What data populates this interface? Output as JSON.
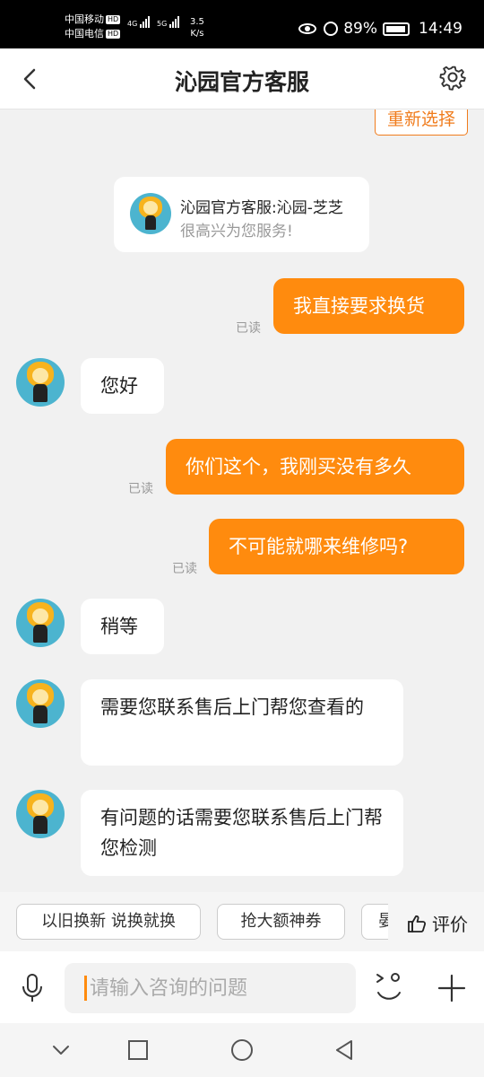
{
  "status_bar": {
    "carrier_1": "中国移动",
    "carrier_2": "中国电信",
    "hd": "HD",
    "net_1": "4G",
    "net_2": "5G",
    "speed_value": "3.5",
    "speed_unit": "K/s",
    "battery": "89%",
    "time": "14:49"
  },
  "header": {
    "title": "沁园官方客服"
  },
  "chat": {
    "reselect_label": "重新选择",
    "intro": {
      "name": "沁园官方客服:沁园-芝芝",
      "greeting": "很高兴为您服务!"
    },
    "read_label": "已读",
    "messages": [
      {
        "side": "right",
        "text": "我直接要求换货"
      },
      {
        "side": "left",
        "text": "您好"
      },
      {
        "side": "right",
        "text": "你们这个，我刚买没有多久"
      },
      {
        "side": "right",
        "text": "不可能就哪来维修吗?"
      },
      {
        "side": "left",
        "text": "稍等"
      },
      {
        "side": "left",
        "text": "需要您联系售后上门帮您查看的"
      },
      {
        "side": "left",
        "text": "有问题的话需要您联系售后上门帮您检测"
      }
    ]
  },
  "quick_bar": {
    "chips": [
      "以旧换新 说换就换",
      "抢大额神券",
      "晏"
    ],
    "rate_label": "评价"
  },
  "input": {
    "placeholder": "请输入咨询的问题"
  },
  "icons": {
    "back": "chevron-left-icon",
    "settings": "gear-icon",
    "mic": "microphone-icon",
    "emoji": "emoji-icon",
    "plus": "plus-icon",
    "thumb": "thumbs-up-icon"
  },
  "colors": {
    "accent": "#ff8b0e",
    "avatar_bg": "#4cb4cf"
  }
}
